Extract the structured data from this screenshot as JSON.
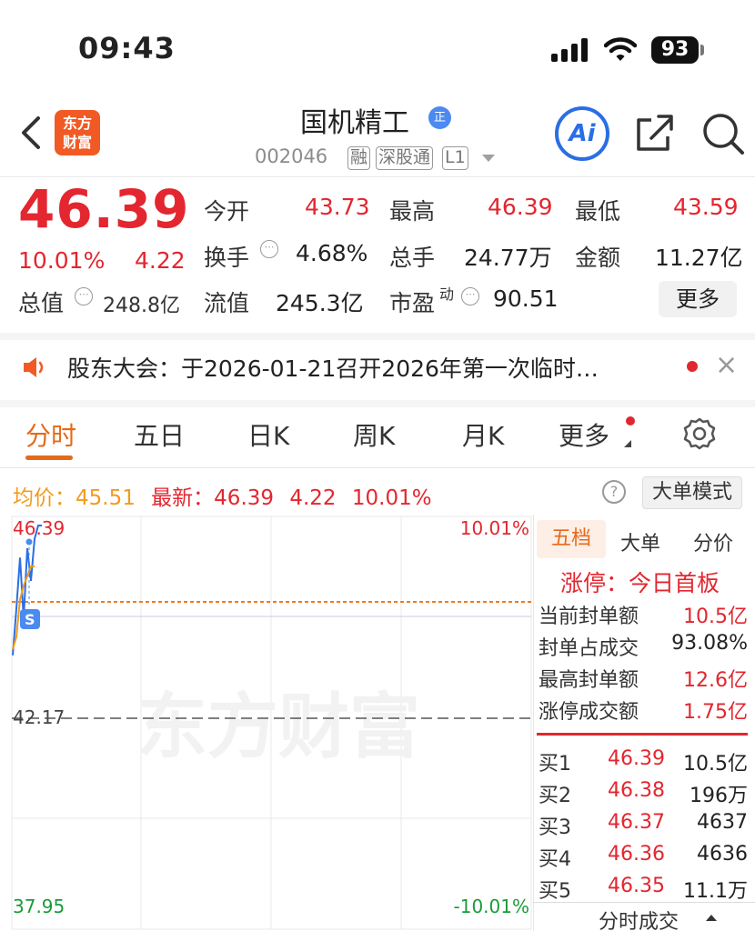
{
  "status_bar": {
    "time": "09:43",
    "battery": "93"
  },
  "header": {
    "logo_text_line1": "东方",
    "logo_text_line2": "财富",
    "stock_name": "国机精工",
    "zheng_badge": "正",
    "stock_code": "002046",
    "tags": [
      "融",
      "深股通",
      "L1"
    ],
    "ai_label": "Ai"
  },
  "quote": {
    "price": "46.39",
    "change_pct": "10.01%",
    "change": "4.22",
    "open_label": "今开",
    "open_value": "43.73",
    "high_label": "最高",
    "high_value": "46.39",
    "low_label": "最低",
    "low_value": "43.59",
    "turnover_label": "换手",
    "turnover_value": "4.68%",
    "volume_label": "总手",
    "volume_value": "24.77万",
    "amount_label": "金额",
    "amount_value": "11.27亿",
    "mktcap_label": "总值",
    "mktcap_value": "248.8亿",
    "float_label": "流值",
    "float_value": "245.3亿",
    "pe_label": "市盈",
    "pe_super": "动",
    "pe_value": "90.51",
    "more_button": "更多"
  },
  "notice": {
    "text": "股东大会：于2026-01-21召开2026年第一次临时…"
  },
  "tabs": [
    {
      "label": "分时"
    },
    {
      "label": "五日"
    },
    {
      "label": "日K"
    },
    {
      "label": "周K"
    },
    {
      "label": "月K"
    },
    {
      "label": "更多"
    }
  ],
  "chart_header": {
    "avg_label": "均价：",
    "avg_value": "45.51",
    "latest_label": "最新：",
    "latest_price": "46.39",
    "latest_change": "4.22",
    "latest_pct": "10.01%",
    "help": "?",
    "big_order_mode": "大单模式"
  },
  "chart": {
    "top_price": "46.39",
    "top_pct": "10.01%",
    "mid_price": "42.17",
    "bottom_price": "37.95",
    "bottom_pct": "-10.01%",
    "watermark": "东方财富",
    "s_marker": "S"
  },
  "chart_data": {
    "type": "line",
    "ylim": [
      37.95,
      46.39
    ],
    "series": [
      {
        "values": [
          43.6,
          44.6,
          45.7,
          44.4,
          45.9,
          45.2,
          46.1,
          46.39,
          46.39
        ]
      },
      {
        "values": [
          43.73,
          44.0,
          44.8,
          45.1,
          45.3,
          45.51,
          45.51
        ]
      }
    ]
  },
  "right_panel": {
    "tabs": [
      "五档",
      "大单",
      "分价"
    ],
    "limit_up_label": "涨停：今日首板",
    "rows": [
      {
        "label": "当前封单额",
        "value": "10.5亿"
      },
      {
        "label": "封单占成交",
        "value": "93.08%"
      },
      {
        "label": "最高封单额",
        "value": "12.6亿"
      },
      {
        "label": "涨停成交额",
        "value": "1.75亿"
      }
    ],
    "bids": [
      {
        "label": "买1",
        "price": "46.39",
        "vol": "10.5亿"
      },
      {
        "label": "买2",
        "price": "46.38",
        "vol": "196万"
      },
      {
        "label": "买3",
        "price": "46.37",
        "vol": "4637"
      },
      {
        "label": "买4",
        "price": "46.36",
        "vol": "4636"
      },
      {
        "label": "买5",
        "price": "46.35",
        "vol": "11.1万"
      }
    ],
    "bottom_label": "分时成交"
  }
}
